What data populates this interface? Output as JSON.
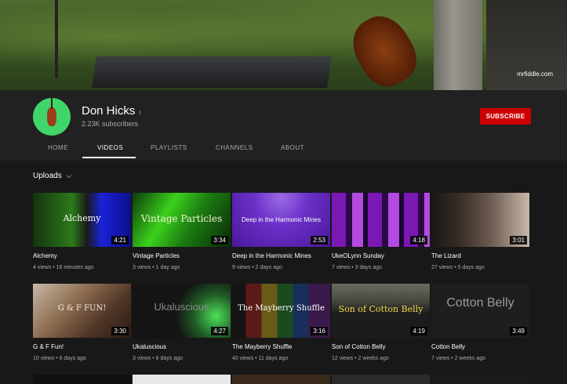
{
  "banner": {
    "credit": "mrfiddle.com"
  },
  "channel": {
    "name": "Don Hicks",
    "note_icon": "music-note-icon",
    "subscribers": "2.23K subscribers",
    "subscribe_label": "SUBSCRIBE",
    "subscribe_color": "#cc0000"
  },
  "tabs": [
    {
      "label": "HOME"
    },
    {
      "label": "VIDEOS"
    },
    {
      "label": "PLAYLISTS"
    },
    {
      "label": "CHANNELS"
    },
    {
      "label": "ABOUT"
    }
  ],
  "active_tab": "VIDEOS",
  "uploads": {
    "label": "Uploads"
  },
  "videos": [
    {
      "title": "Alchemy",
      "meta": "4 views • 16 minutes ago",
      "duration": "4:21",
      "thumb_text": "Alchemy"
    },
    {
      "title": "Vintage Particles",
      "meta": "3 views • 1 day ago",
      "duration": "3:34",
      "thumb_text": "Vintage Particles"
    },
    {
      "title": "Deep in the Harmonic Mines",
      "meta": "9 views • 2 days ago",
      "duration": "2:53",
      "thumb_text": "Deep in the Harmonic Mines"
    },
    {
      "title": "UkeOLynn Sunday",
      "meta": "7 views • 3 days ago",
      "duration": "4:18",
      "thumb_text": ""
    },
    {
      "title": "The Lizard",
      "meta": "27 views • 5 days ago",
      "duration": "3:01",
      "thumb_text": ""
    },
    {
      "title": "G & F Fun!",
      "meta": "10 views • 6 days ago",
      "duration": "3:30",
      "thumb_text": "G & F FUN!"
    },
    {
      "title": "Ukaluscious",
      "meta": "3 views • 8 days ago",
      "duration": "4:27",
      "thumb_text": "Ukaluscious"
    },
    {
      "title": "The Mayberry Shuffle",
      "meta": "40 views • 11 days ago",
      "duration": "3:16",
      "thumb_text": "The Mayberry Shuffle"
    },
    {
      "title": "Son of Cotton Belly",
      "meta": "12 views • 2 weeks ago",
      "duration": "4:19",
      "thumb_text": "Son of Cotton Belly"
    },
    {
      "title": "Cotton Belly",
      "meta": "7 views • 2 weeks ago",
      "duration": "3:49",
      "thumb_text": "Cotton Belly"
    }
  ]
}
